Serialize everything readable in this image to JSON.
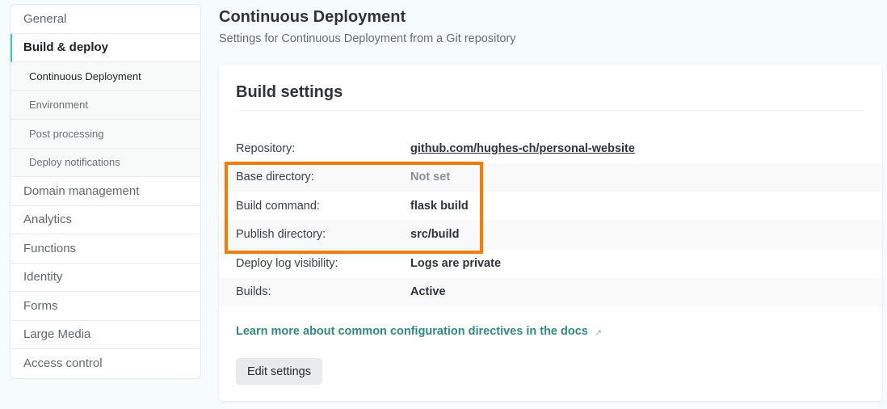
{
  "sidebar": {
    "items": [
      {
        "label": "General"
      },
      {
        "label": "Build & deploy",
        "active": true
      },
      {
        "label": "Domain management"
      },
      {
        "label": "Analytics"
      },
      {
        "label": "Functions"
      },
      {
        "label": "Identity"
      },
      {
        "label": "Forms"
      },
      {
        "label": "Large Media"
      },
      {
        "label": "Access control"
      }
    ],
    "subitems": [
      {
        "label": "Continuous Deployment",
        "current": true
      },
      {
        "label": "Environment"
      },
      {
        "label": "Post processing"
      },
      {
        "label": "Deploy notifications"
      }
    ]
  },
  "header": {
    "title": "Continuous Deployment",
    "subtitle": "Settings for Continuous Deployment from a Git repository"
  },
  "card": {
    "title": "Build settings",
    "rows": [
      {
        "label": "Repository:",
        "value": "github.com/hughes-ch/personal-website"
      },
      {
        "label": "Base directory:",
        "value": "Not set"
      },
      {
        "label": "Build command:",
        "value": "flask build"
      },
      {
        "label": "Publish directory:",
        "value": "src/build"
      },
      {
        "label": "Deploy log visibility:",
        "value": "Logs are private"
      },
      {
        "label": "Builds:",
        "value": "Active"
      }
    ],
    "docs_link": "Learn more about common configuration directives in the docs",
    "docs_link_icon": "↗",
    "edit_button": "Edit settings"
  },
  "colors": {
    "accent_teal": "#30c8c0",
    "link_teal": "#2e8a82",
    "highlight_orange": "#ff7a00"
  }
}
